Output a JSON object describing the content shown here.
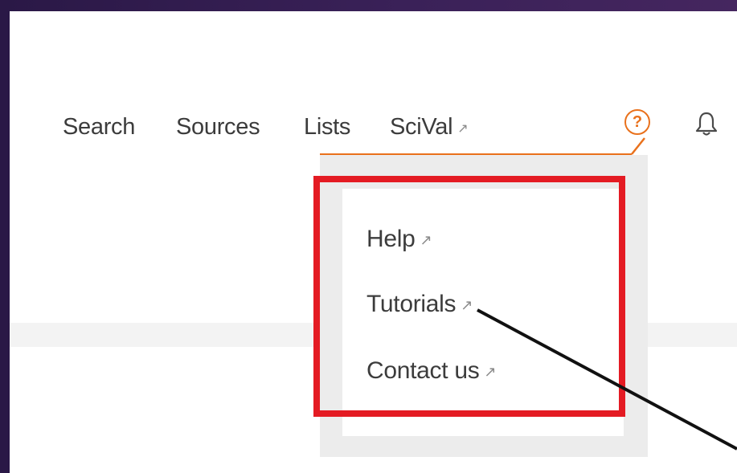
{
  "nav": {
    "items": [
      {
        "label": "Search"
      },
      {
        "label": "Sources"
      },
      {
        "label": "Lists"
      },
      {
        "label": "SciVal",
        "external_glyph": "↗"
      }
    ]
  },
  "icons": {
    "help": {
      "name": "help-circle-icon",
      "glyph": "?",
      "color": "#e9711c"
    },
    "bell": {
      "name": "bell-icon"
    }
  },
  "dropdown": {
    "items": [
      {
        "label": "Help",
        "external_glyph": "↗"
      },
      {
        "label": "Tutorials",
        "external_glyph": "↗"
      },
      {
        "label": "Contact us",
        "external_glyph": "↗"
      }
    ]
  },
  "colors": {
    "accent": "#e9711c",
    "highlight": "#e41b23",
    "text": "#3c3c3c"
  }
}
